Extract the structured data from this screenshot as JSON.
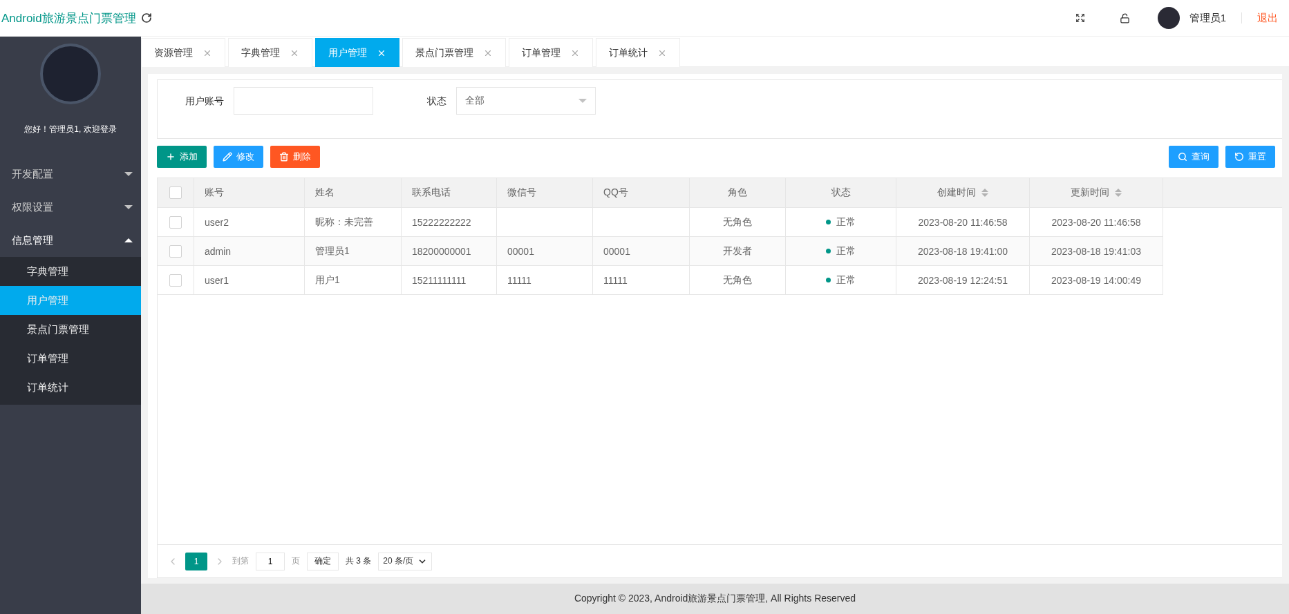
{
  "header": {
    "app_title": "Android旅游景点门票管理",
    "user_name": "管理员1",
    "logout": "退出"
  },
  "tabs": [
    {
      "label": "资源管理",
      "selected": false
    },
    {
      "label": "字典管理",
      "selected": false
    },
    {
      "label": "用户管理",
      "selected": true
    },
    {
      "label": "景点门票管理",
      "selected": false
    },
    {
      "label": "订单管理",
      "selected": false
    },
    {
      "label": "订单统计",
      "selected": false
    }
  ],
  "sidebar": {
    "greeting": "您好！管理员1, 欢迎登录",
    "items": [
      {
        "label": "开发配置",
        "expanded": false
      },
      {
        "label": "权限设置",
        "expanded": false
      },
      {
        "label": "信息管理",
        "expanded": true,
        "children": [
          {
            "label": "字典管理",
            "selected": false
          },
          {
            "label": "用户管理",
            "selected": true
          },
          {
            "label": "景点门票管理",
            "selected": false
          },
          {
            "label": "订单管理",
            "selected": false
          },
          {
            "label": "订单统计",
            "selected": false
          }
        ]
      }
    ]
  },
  "filters": [
    {
      "kind": "text",
      "label": "用户账号"
    },
    {
      "kind": "select",
      "label": "状态",
      "value": "全部"
    }
  ],
  "toolbar": {
    "left": [
      {
        "kind": "add",
        "label": "添加"
      },
      {
        "kind": "edit",
        "label": "修改"
      },
      {
        "kind": "delete",
        "label": "删除"
      }
    ],
    "right": [
      {
        "kind": "search",
        "label": "查询"
      },
      {
        "kind": "reset",
        "label": "重置"
      }
    ]
  },
  "table": {
    "select_all": {
      "checked": false
    },
    "columns": [
      {
        "label": "账号"
      },
      {
        "label": "姓名"
      },
      {
        "label": "联系电话"
      },
      {
        "label": "微信号"
      },
      {
        "label": "QQ号"
      },
      {
        "label": "角色"
      },
      {
        "label": "状态"
      },
      {
        "label": "创建时间",
        "sortable": true
      },
      {
        "label": "更新时间",
        "sortable": true
      }
    ],
    "rows": [
      {
        "checked": false,
        "cells": [
          "user2",
          "昵称：未完善",
          "15222222222",
          "",
          "",
          "无角色"
        ],
        "status": "正常",
        "color": "#009688",
        "times": [
          "2023-08-20 11:46:58",
          "2023-08-20 11:46:58"
        ]
      },
      {
        "checked": false,
        "cells": [
          "admin",
          "管理员1",
          "18200000001",
          "00001",
          "00001",
          "开发者"
        ],
        "status": "正常",
        "color": "#009688",
        "times": [
          "2023-08-18 19:41:00",
          "2023-08-18 19:41:03"
        ]
      },
      {
        "checked": false,
        "cells": [
          "user1",
          "用户1",
          "15211111111",
          "11111",
          "11111",
          "无角色"
        ],
        "status": "正常",
        "color": "#009688",
        "times": [
          "2023-08-19 12:24:51",
          "2023-08-19 14:00:49"
        ]
      }
    ]
  },
  "pagination": {
    "pages": [
      {
        "label": "1",
        "selected": true
      }
    ],
    "goto_label": "到第",
    "goto_value": "1",
    "page_unit": "页",
    "confirm": "确定",
    "total": "共 3 条",
    "page_size": "20 条/页"
  },
  "footer": "Copyright © 2023, Android旅游景点门票管理, All Rights Reserved"
}
